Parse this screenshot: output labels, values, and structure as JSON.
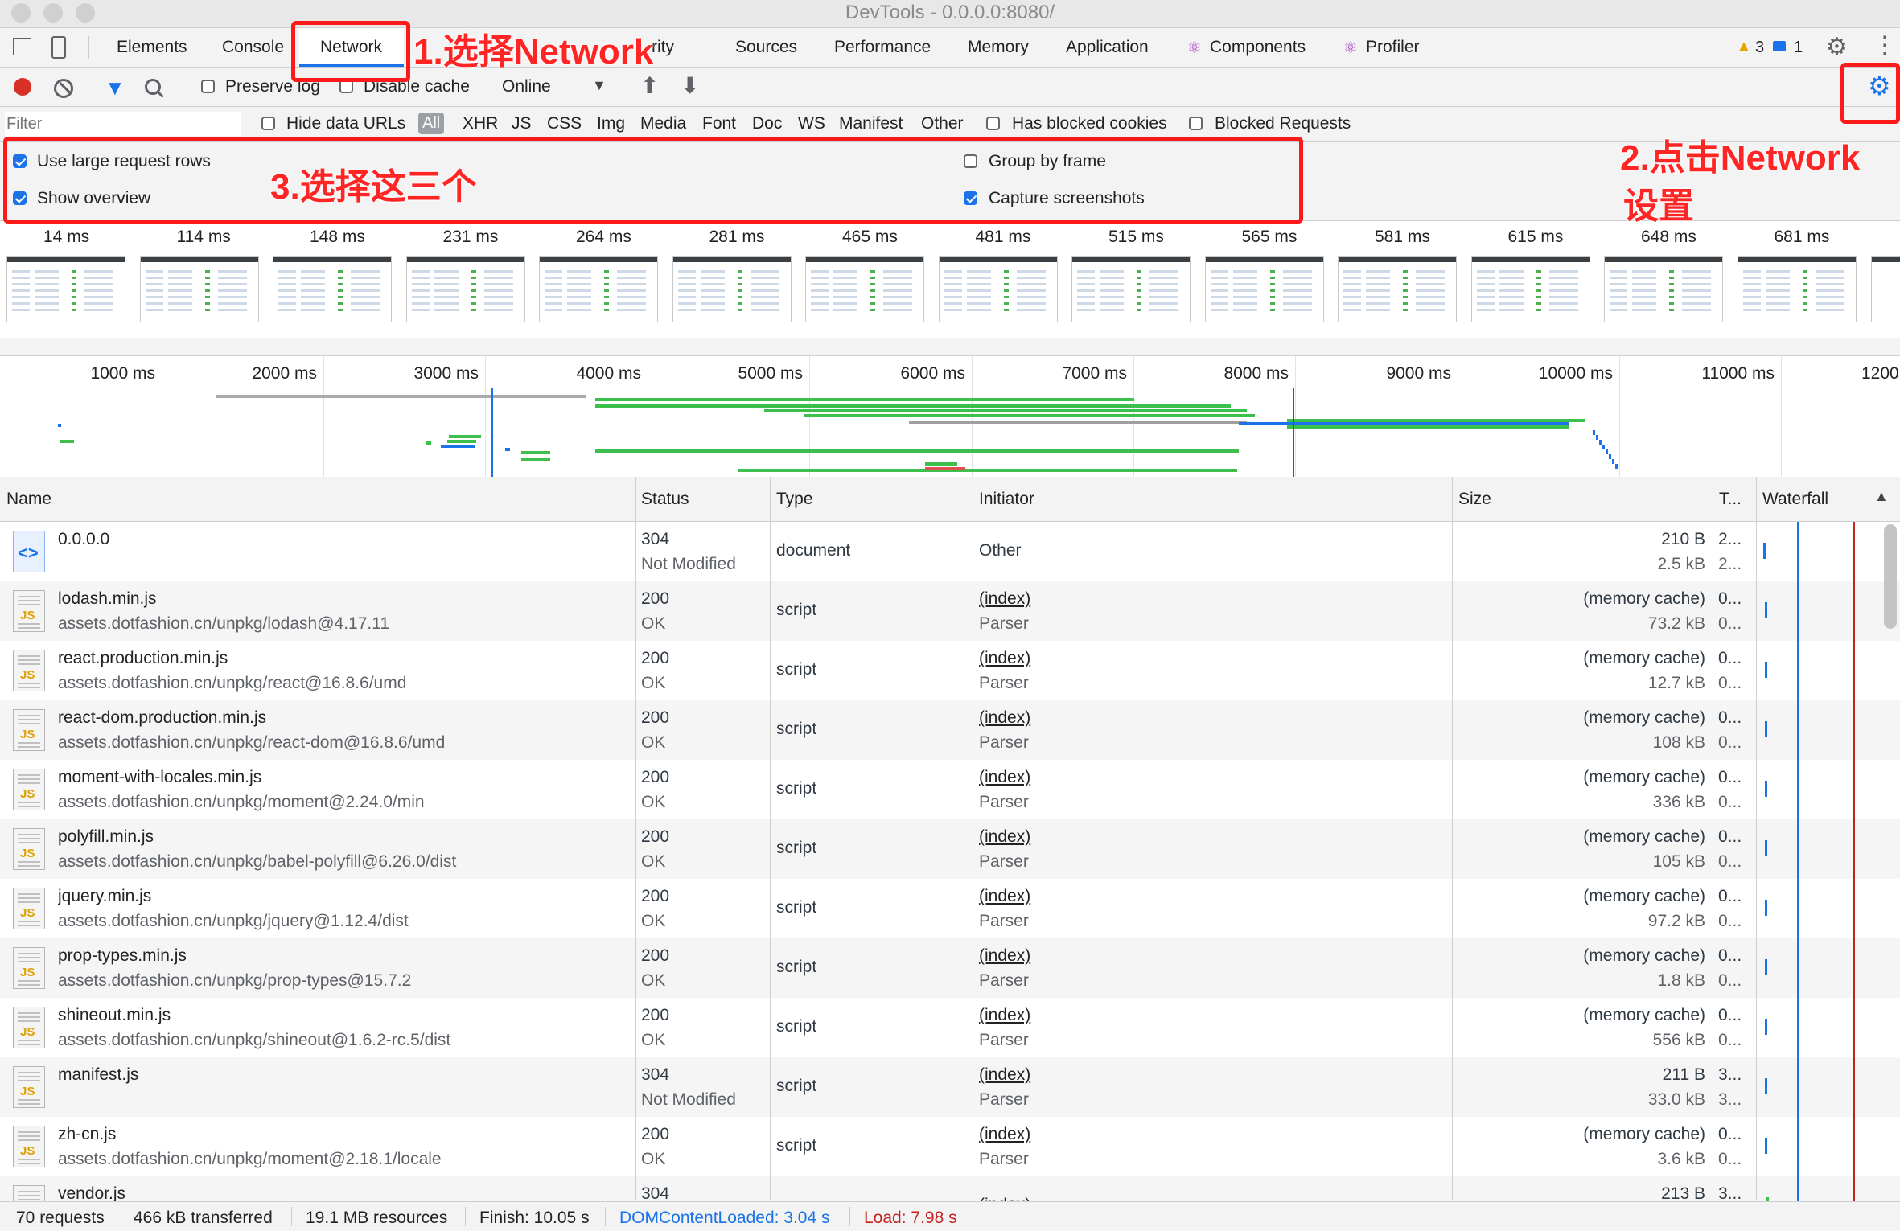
{
  "window": {
    "title": "DevTools - 0.0.0.0:8080/"
  },
  "tabs": [
    {
      "label": "Elements"
    },
    {
      "label": "Console"
    },
    {
      "label": "Network"
    },
    {
      "label": "rity"
    },
    {
      "label": "Sources"
    },
    {
      "label": "Performance"
    },
    {
      "label": "Memory"
    },
    {
      "label": "Application"
    },
    {
      "label": "Components"
    },
    {
      "label": "Profiler"
    }
  ],
  "badges": {
    "warnings": "3",
    "messages": "1"
  },
  "toolbar": {
    "preserve_log": "Preserve log",
    "disable_cache": "Disable cache",
    "throttle": "Online"
  },
  "filterbar": {
    "placeholder": "Filter",
    "hide_data_urls": "Hide data URLs",
    "types": [
      "All",
      "XHR",
      "JS",
      "CSS",
      "Img",
      "Media",
      "Font",
      "Doc",
      "WS",
      "Manifest",
      "Other"
    ],
    "has_blocked_cookies": "Has blocked cookies",
    "blocked_requests": "Blocked Requests"
  },
  "settings": {
    "large_rows": "Use large request rows",
    "show_overview": "Show overview",
    "group_by_frame": "Group by frame",
    "capture_screenshots": "Capture screenshots"
  },
  "annotations": {
    "step1": "1.选择Network",
    "step2_line1": "2.点击Network",
    "step2_line2": "设置",
    "step3": "3.选择这三个"
  },
  "screenshots": [
    "14 ms",
    "114 ms",
    "148 ms",
    "231 ms",
    "264 ms",
    "281 ms",
    "465 ms",
    "481 ms",
    "515 ms",
    "565 ms",
    "581 ms",
    "615 ms",
    "648 ms",
    "681 ms"
  ],
  "timeline_ticks": [
    "1000 ms",
    "2000 ms",
    "3000 ms",
    "4000 ms",
    "5000 ms",
    "6000 ms",
    "7000 ms",
    "8000 ms",
    "9000 ms",
    "10000 ms",
    "11000 ms",
    "1200"
  ],
  "columns": {
    "name": "Name",
    "status": "Status",
    "type": "Type",
    "initiator": "Initiator",
    "size": "Size",
    "time": "T...",
    "waterfall": "Waterfall"
  },
  "requests": [
    {
      "name": "0.0.0.0",
      "path": "",
      "status": "304",
      "status_text": "Not Modified",
      "type": "document",
      "initiator": "Other",
      "initiator2": "",
      "size": "210 B",
      "size2": "2.5 kB",
      "time": "2...",
      "time2": "2...",
      "icon": "document"
    },
    {
      "name": "lodash.min.js",
      "path": "assets.dotfashion.cn/unpkg/lodash@4.17.11",
      "status": "200",
      "status_text": "OK",
      "type": "script",
      "initiator": "(index)",
      "initiator2": "Parser",
      "size": "(memory cache)",
      "size2": "73.2 kB",
      "time": "0...",
      "time2": "0...",
      "icon": "js"
    },
    {
      "name": "react.production.min.js",
      "path": "assets.dotfashion.cn/unpkg/react@16.8.6/umd",
      "status": "200",
      "status_text": "OK",
      "type": "script",
      "initiator": "(index)",
      "initiator2": "Parser",
      "size": "(memory cache)",
      "size2": "12.7 kB",
      "time": "0...",
      "time2": "0...",
      "icon": "js"
    },
    {
      "name": "react-dom.production.min.js",
      "path": "assets.dotfashion.cn/unpkg/react-dom@16.8.6/umd",
      "status": "200",
      "status_text": "OK",
      "type": "script",
      "initiator": "(index)",
      "initiator2": "Parser",
      "size": "(memory cache)",
      "size2": "108 kB",
      "time": "0...",
      "time2": "0...",
      "icon": "js"
    },
    {
      "name": "moment-with-locales.min.js",
      "path": "assets.dotfashion.cn/unpkg/moment@2.24.0/min",
      "status": "200",
      "status_text": "OK",
      "type": "script",
      "initiator": "(index)",
      "initiator2": "Parser",
      "size": "(memory cache)",
      "size2": "336 kB",
      "time": "0...",
      "time2": "0...",
      "icon": "js"
    },
    {
      "name": "polyfill.min.js",
      "path": "assets.dotfashion.cn/unpkg/babel-polyfill@6.26.0/dist",
      "status": "200",
      "status_text": "OK",
      "type": "script",
      "initiator": "(index)",
      "initiator2": "Parser",
      "size": "(memory cache)",
      "size2": "105 kB",
      "time": "0...",
      "time2": "0...",
      "icon": "js"
    },
    {
      "name": "jquery.min.js",
      "path": "assets.dotfashion.cn/unpkg/jquery@1.12.4/dist",
      "status": "200",
      "status_text": "OK",
      "type": "script",
      "initiator": "(index)",
      "initiator2": "Parser",
      "size": "(memory cache)",
      "size2": "97.2 kB",
      "time": "0...",
      "time2": "0...",
      "icon": "js"
    },
    {
      "name": "prop-types.min.js",
      "path": "assets.dotfashion.cn/unpkg/prop-types@15.7.2",
      "status": "200",
      "status_text": "OK",
      "type": "script",
      "initiator": "(index)",
      "initiator2": "Parser",
      "size": "(memory cache)",
      "size2": "1.8 kB",
      "time": "0...",
      "time2": "0...",
      "icon": "js"
    },
    {
      "name": "shineout.min.js",
      "path": "assets.dotfashion.cn/unpkg/shineout@1.6.2-rc.5/dist",
      "status": "200",
      "status_text": "OK",
      "type": "script",
      "initiator": "(index)",
      "initiator2": "Parser",
      "size": "(memory cache)",
      "size2": "556 kB",
      "time": "0...",
      "time2": "0...",
      "icon": "js"
    },
    {
      "name": "manifest.js",
      "path": "",
      "status": "304",
      "status_text": "Not Modified",
      "type": "script",
      "initiator": "(index)",
      "initiator2": "Parser",
      "size": "211 B",
      "size2": "33.0 kB",
      "time": "3...",
      "time2": "3...",
      "icon": "js"
    },
    {
      "name": "zh-cn.js",
      "path": "assets.dotfashion.cn/unpkg/moment@2.18.1/locale",
      "status": "200",
      "status_text": "OK",
      "type": "script",
      "initiator": "(index)",
      "initiator2": "Parser",
      "size": "(memory cache)",
      "size2": "3.6 kB",
      "time": "0...",
      "time2": "0...",
      "icon": "js"
    },
    {
      "name": "vendor.js",
      "path": "",
      "status": "304",
      "status_text": "",
      "type": "",
      "initiator": "(index)",
      "initiator2": "",
      "size": "213 B",
      "size2": "",
      "time": "3...",
      "time2": "",
      "icon": "js"
    }
  ],
  "statusbar": {
    "requests": "70 requests",
    "transferred": "466 kB transferred",
    "resources": "19.1 MB resources",
    "finish": "Finish: 10.05 s",
    "dcl": "DOMContentLoaded: 3.04 s",
    "load": "Load: 7.98 s"
  },
  "colors": {
    "accent": "#1a73e8",
    "annotation": "#ff1a1a",
    "dcl": "#1a73e8",
    "load": "#c5221f"
  }
}
